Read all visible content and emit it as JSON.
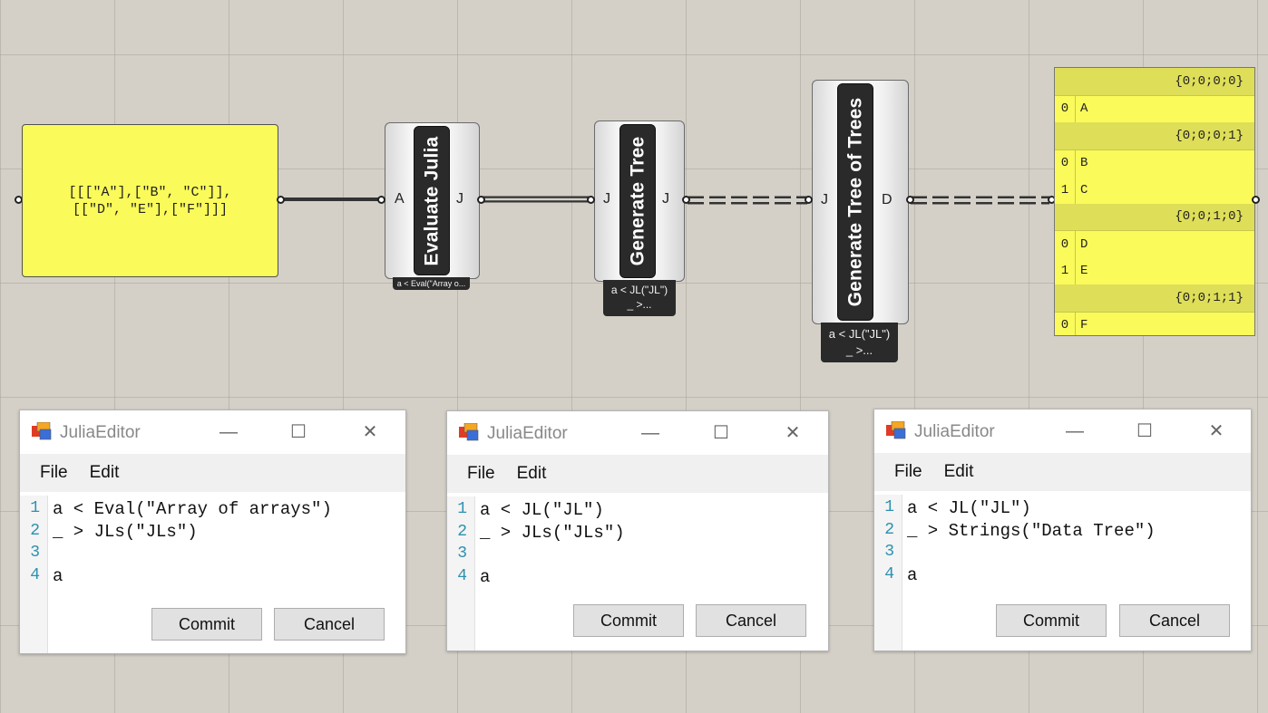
{
  "canvas": {
    "panel": {
      "text_line1": "[[[\"A\"],[\"B\", \"C\"]],",
      "text_line2": "[[\"D\", \"E\"],[\"F\"]]]"
    },
    "components": [
      {
        "title": "Evaluate Julia",
        "input": "A",
        "output": "J",
        "tag": "a < Eval(\"Array o..."
      },
      {
        "title": "Generate Tree",
        "input": "J",
        "output": "J",
        "tag_line1": "a < JL(\"JL\")",
        "tag_line2": "_ >..."
      },
      {
        "title": "Generate Tree of Trees",
        "input": "J",
        "output": "D",
        "tag_line1": "a < JL(\"JL\")",
        "tag_line2": "_ >..."
      }
    ],
    "tree": {
      "branches": [
        {
          "path": "{0;0;0;0}",
          "items": [
            {
              "i": "0",
              "v": "A"
            }
          ]
        },
        {
          "path": "{0;0;0;1}",
          "items": [
            {
              "i": "0",
              "v": "B"
            },
            {
              "i": "1",
              "v": "C"
            }
          ]
        },
        {
          "path": "{0;0;1;0}",
          "items": [
            {
              "i": "0",
              "v": "D"
            },
            {
              "i": "1",
              "v": "E"
            }
          ]
        },
        {
          "path": "{0;0;1;1}",
          "items": [
            {
              "i": "0",
              "v": "F"
            }
          ]
        }
      ]
    }
  },
  "editors": [
    {
      "title": "JuliaEditor",
      "menu": [
        "File",
        "Edit"
      ],
      "lines": [
        "a < Eval(\"Array of arrays\")",
        "_ > JLs(\"JLs\")",
        "",
        "a"
      ],
      "commit": "Commit",
      "cancel": "Cancel"
    },
    {
      "title": "JuliaEditor",
      "menu": [
        "File",
        "Edit"
      ],
      "lines": [
        "a < JL(\"JL\")",
        "_ > JLs(\"JLs\")",
        "",
        "a"
      ],
      "commit": "Commit",
      "cancel": "Cancel"
    },
    {
      "title": "JuliaEditor",
      "menu": [
        "File",
        "Edit"
      ],
      "lines": [
        "a < JL(\"JL\")",
        "_ > Strings(\"Data Tree\")",
        "",
        "a"
      ],
      "commit": "Commit",
      "cancel": "Cancel"
    }
  ],
  "line_numbers": [
    "1",
    "2",
    "3",
    "4"
  ],
  "window_controls": {
    "minimize": "—",
    "maximize": "☐",
    "close": "✕"
  }
}
